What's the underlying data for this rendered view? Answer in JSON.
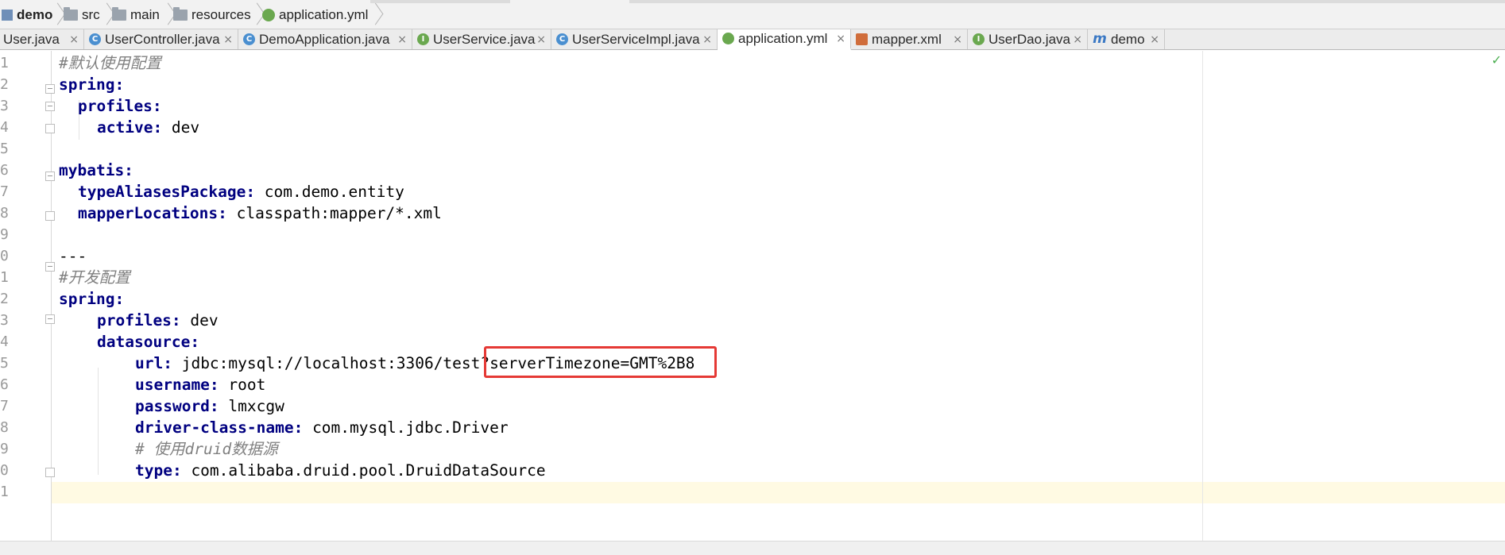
{
  "breadcrumb": [
    "demo",
    "src",
    "main",
    "resources",
    "application.yml"
  ],
  "tabs": [
    {
      "label": "User.java",
      "icon": "class-icon"
    },
    {
      "label": "UserController.java",
      "icon": "class-icon"
    },
    {
      "label": "DemoApplication.java",
      "icon": "spring-class-icon"
    },
    {
      "label": "UserService.java",
      "icon": "interface-icon"
    },
    {
      "label": "UserServiceImpl.java",
      "icon": "class-icon"
    },
    {
      "label": "application.yml",
      "icon": "yaml-icon",
      "active": true
    },
    {
      "label": "mapper.xml",
      "icon": "xml-icon"
    },
    {
      "label": "UserDao.java",
      "icon": "interface-icon"
    },
    {
      "label": "demo",
      "icon": "maven-icon"
    }
  ],
  "close_glyph": "×",
  "line_numbers": [
    "1",
    "2",
    "3",
    "4",
    "5",
    "6",
    "7",
    "8",
    "9",
    "0",
    "1",
    "2",
    "3",
    "4",
    "5",
    "6",
    "7",
    "8",
    "9",
    "0",
    "1"
  ],
  "code": {
    "l1": "#默认使用配置",
    "l2k": "spring:",
    "l3k": "profiles:",
    "l4k": "active:",
    "l4v": " dev",
    "l6k": "mybatis:",
    "l7k": "typeAliasesPackage:",
    "l7v": " com.demo.entity",
    "l8k": "mapperLocations:",
    "l8v": " classpath:mapper/*.xml",
    "l10": "---",
    "l11": "#开发配置",
    "l12k": "spring:",
    "l13k": "profiles:",
    "l13v": " dev",
    "l14k": "datasource:",
    "l15k": "url:",
    "l15v": " jdbc:mysql://localhost:3306/test?serverTimezone=GMT%2B8",
    "l16k": "username:",
    "l16v": " root",
    "l17k": "password:",
    "l17v": " lmxcgw",
    "l18k": "driver-class-name:",
    "l18v": " com.mysql.jdbc.Driver",
    "l19": "# 使用druid数据源",
    "l20k": "type:",
    "l20v": " com.alibaba.druid.pool.DruidDataSource"
  },
  "colors": {
    "keyword": "#000080",
    "comment": "#808080",
    "highlight": "#e53935",
    "caret_line": "#fffae3"
  }
}
